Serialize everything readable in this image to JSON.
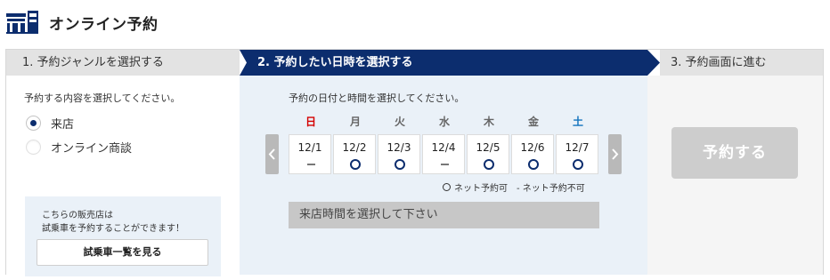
{
  "header": {
    "title": "オンライン予約",
    "icon": "shop-calendar-icon",
    "brand_color": "#0c2d6e"
  },
  "steps": [
    {
      "label": "1. 予約ジャンルを選択する",
      "active": false
    },
    {
      "label": "2. 予約したい日時を選択する",
      "active": true
    },
    {
      "label": "3. 予約画面に進む",
      "active": false
    }
  ],
  "genre": {
    "instruction": "予約する内容を選択してください。",
    "options": [
      {
        "label": "来店",
        "checked": true
      },
      {
        "label": "オンライン商談",
        "checked": false
      }
    ],
    "promo": {
      "line1": "こちらの販売店は",
      "line2": "試乗車を予約することができます！",
      "button": "試乗車一覧を見る"
    }
  },
  "schedule": {
    "instruction": "予約の日付と時間を選択してください。",
    "weekdays": [
      "日",
      "月",
      "火",
      "水",
      "木",
      "金",
      "土"
    ],
    "dates": [
      {
        "date": "12/1",
        "status": "unavailable"
      },
      {
        "date": "12/2",
        "status": "available"
      },
      {
        "date": "12/3",
        "status": "available"
      },
      {
        "date": "12/4",
        "status": "unavailable"
      },
      {
        "date": "12/5",
        "status": "available"
      },
      {
        "date": "12/6",
        "status": "available"
      },
      {
        "date": "12/7",
        "status": "available"
      }
    ],
    "legend": {
      "available": "ネット予約可",
      "unavailable": "- ネット予約不可"
    },
    "time_placeholder": "来店時間を選択して下さい"
  },
  "proceed": {
    "button": "予約する"
  },
  "colors": {
    "navy": "#0c2d6e",
    "sunday": "#d40000",
    "saturday": "#1574bd",
    "panel_blue": "#eaf1f8",
    "disabled": "#cdcdcd"
  }
}
